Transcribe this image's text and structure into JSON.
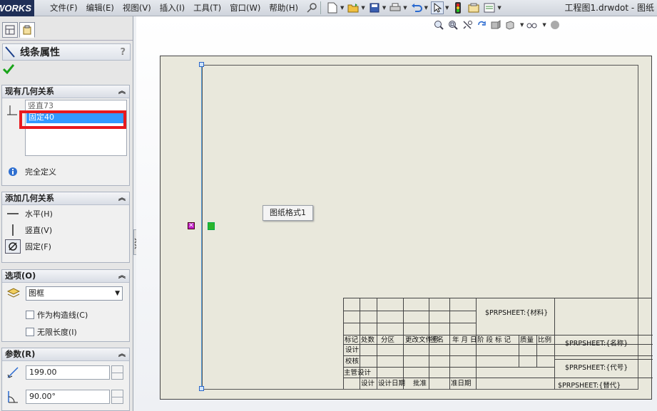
{
  "app": {
    "logo_text": "WORKS",
    "window_title": "工程图1.drwdot - 图纸"
  },
  "menu": [
    "文件(F)",
    "编辑(E)",
    "视图(V)",
    "插入(I)",
    "工具(T)",
    "窗口(W)",
    "帮助(H)"
  ],
  "toolbar": {
    "icons": [
      "pushpin-icon",
      "new-document-icon",
      "open-icon",
      "save-icon",
      "print-icon",
      "undo-icon",
      "select-arrow-icon",
      "traffic-light-icon",
      "options-icon",
      "properties-icon"
    ]
  },
  "property_manager": {
    "title": "线条属性",
    "help": "?",
    "existing_relations": {
      "header": "现有几何关系",
      "items": [
        "竖直73",
        "固定40"
      ],
      "selected_index": 1,
      "status": "完全定义"
    },
    "add_relations": {
      "header": "添加几何关系",
      "items": [
        "水平(H)",
        "竖直(V)",
        "固定(F)"
      ]
    },
    "options": {
      "header": "选项(O)",
      "layer_value": "图框",
      "construction_label": "作为构造线(C)",
      "infinite_label": "无限长度(I)"
    },
    "parameters": {
      "header": "参数(R)",
      "length": "199.00",
      "angle": "90.00°"
    }
  },
  "canvas": {
    "tooltip": "图纸格式1",
    "title_block": {
      "material": "$PRPSHEET:{材料}",
      "name": "$PRPSHEET:{名称}",
      "code": "$PRPSHEET:{代号}",
      "replace": "$PRPSHEET:{替代}",
      "headers": [
        "标记",
        "处数",
        "分区",
        "更改文件号",
        "签名",
        "年 月 日"
      ],
      "stage_headers": [
        "阶 段 标 记",
        "质量",
        "比例"
      ],
      "rows": [
        "设计",
        "校核",
        "主管设计",
        "设计",
        "设计日期",
        "批准",
        "准日期"
      ]
    }
  },
  "colors": {
    "selection": "#3399ff",
    "highlight_box": "#e8191e",
    "sketch_line": "#58a0dc"
  }
}
